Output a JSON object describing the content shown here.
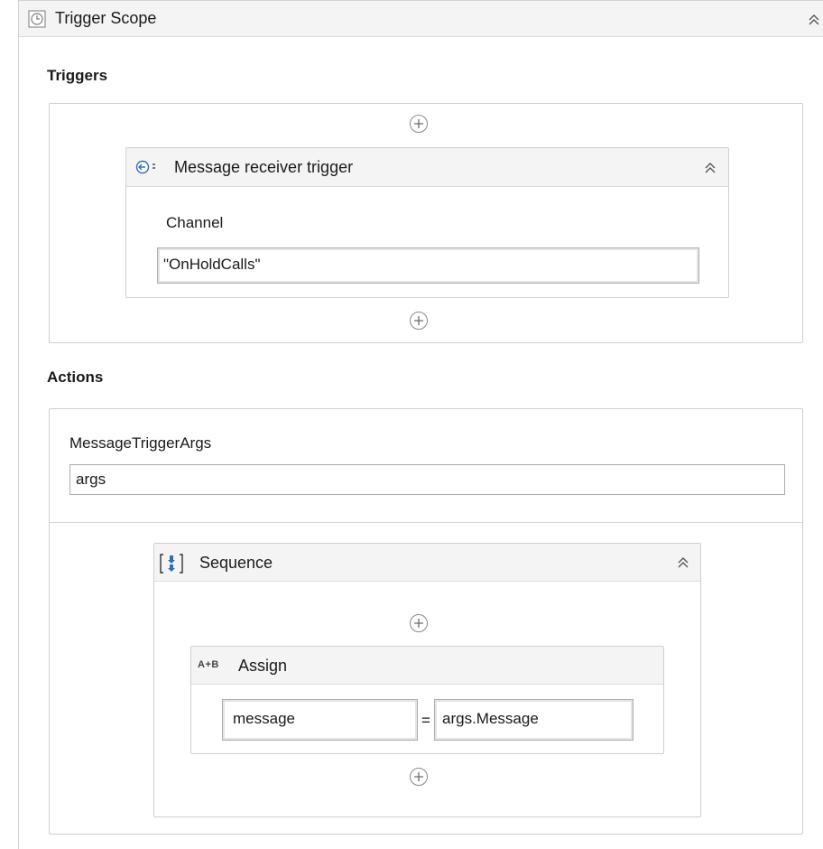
{
  "trigger_scope": {
    "title": "Trigger Scope",
    "icon": "clock-icon"
  },
  "triggers": {
    "label": "Triggers",
    "message_receiver": {
      "title": "Message receiver trigger",
      "icon": "message-receiver-icon",
      "channel_label": "Channel",
      "channel_value": "\"OnHoldCalls\""
    }
  },
  "actions": {
    "label": "Actions",
    "args_label": "MessageTriggerArgs",
    "args_value": "args",
    "sequence": {
      "title": "Sequence",
      "icon": "sequence-icon",
      "assign": {
        "title": "Assign",
        "icon_text": "A+B",
        "to_value": "message",
        "equals": "=",
        "value": "args.Message"
      }
    }
  }
}
